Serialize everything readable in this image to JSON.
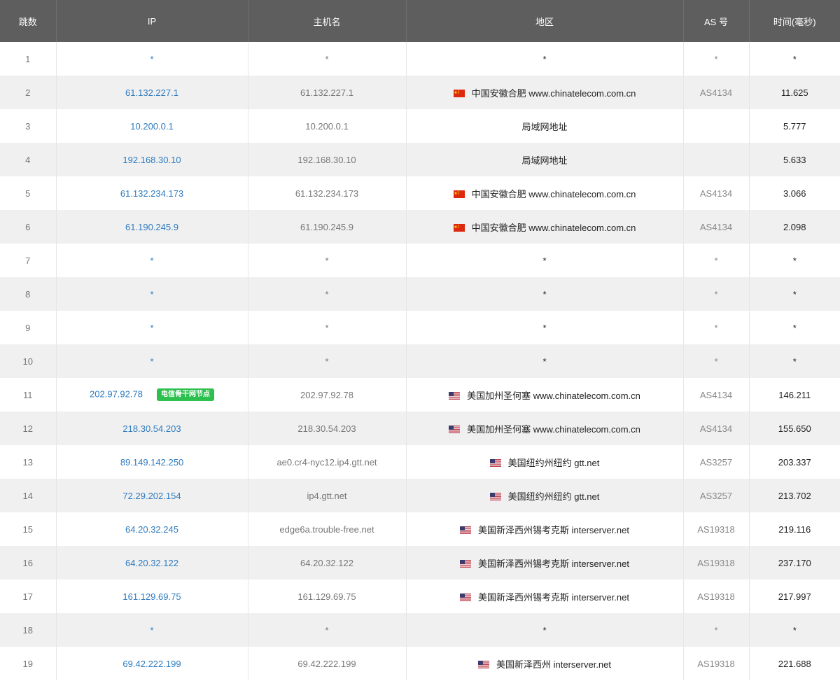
{
  "columns": [
    "跳数",
    "IP",
    "主机名",
    "地区",
    "AS 号",
    "时间(毫秒)"
  ],
  "rows": [
    {
      "hop": "1",
      "ip": "*",
      "host": "*",
      "flag": "",
      "region": "*",
      "as": "*",
      "time": "*"
    },
    {
      "hop": "2",
      "ip": "61.132.227.1",
      "host": "61.132.227.1",
      "flag": "cn-flag-icon",
      "region": "中国安徽合肥 www.chinatelecom.com.cn",
      "as": "AS4134",
      "time": "11.625"
    },
    {
      "hop": "3",
      "ip": "10.200.0.1",
      "host": "10.200.0.1",
      "flag": "",
      "region": "局域网地址",
      "as": "",
      "time": "5.777"
    },
    {
      "hop": "4",
      "ip": "192.168.30.10",
      "host": "192.168.30.10",
      "flag": "",
      "region": "局域网地址",
      "as": "",
      "time": "5.633"
    },
    {
      "hop": "5",
      "ip": "61.132.234.173",
      "host": "61.132.234.173",
      "flag": "cn-flag-icon",
      "region": "中国安徽合肥 www.chinatelecom.com.cn",
      "as": "AS4134",
      "time": "3.066"
    },
    {
      "hop": "6",
      "ip": "61.190.245.9",
      "host": "61.190.245.9",
      "flag": "cn-flag-icon",
      "region": "中国安徽合肥 www.chinatelecom.com.cn",
      "as": "AS4134",
      "time": "2.098"
    },
    {
      "hop": "7",
      "ip": "*",
      "host": "*",
      "flag": "",
      "region": "*",
      "as": "*",
      "time": "*"
    },
    {
      "hop": "8",
      "ip": "*",
      "host": "*",
      "flag": "",
      "region": "*",
      "as": "*",
      "time": "*"
    },
    {
      "hop": "9",
      "ip": "*",
      "host": "*",
      "flag": "",
      "region": "*",
      "as": "*",
      "time": "*"
    },
    {
      "hop": "10",
      "ip": "*",
      "host": "*",
      "flag": "",
      "region": "*",
      "as": "*",
      "time": "*"
    },
    {
      "hop": "11",
      "ip": "202.97.92.78",
      "badge": "电信骨干网节点",
      "host": "202.97.92.78",
      "flag": "us-flag-icon",
      "region": "美国加州圣何塞 www.chinatelecom.com.cn",
      "as": "AS4134",
      "time": "146.211"
    },
    {
      "hop": "12",
      "ip": "218.30.54.203",
      "host": "218.30.54.203",
      "flag": "us-flag-icon",
      "region": "美国加州圣何塞 www.chinatelecom.com.cn",
      "as": "AS4134",
      "time": "155.650"
    },
    {
      "hop": "13",
      "ip": "89.149.142.250",
      "host": "ae0.cr4-nyc12.ip4.gtt.net",
      "flag": "us-flag-icon",
      "region": "美国纽约州纽约 gtt.net",
      "as": "AS3257",
      "time": "203.337"
    },
    {
      "hop": "14",
      "ip": "72.29.202.154",
      "host": "ip4.gtt.net",
      "flag": "us-flag-icon",
      "region": "美国纽约州纽约 gtt.net",
      "as": "AS3257",
      "time": "213.702"
    },
    {
      "hop": "15",
      "ip": "64.20.32.245",
      "host": "edge6a.trouble-free.net",
      "flag": "us-flag-icon",
      "region": "美国新泽西州锡考克斯 interserver.net",
      "as": "AS19318",
      "time": "219.116"
    },
    {
      "hop": "16",
      "ip": "64.20.32.122",
      "host": "64.20.32.122",
      "flag": "us-flag-icon",
      "region": "美国新泽西州锡考克斯 interserver.net",
      "as": "AS19318",
      "time": "237.170"
    },
    {
      "hop": "17",
      "ip": "161.129.69.75",
      "host": "161.129.69.75",
      "flag": "us-flag-icon",
      "region": "美国新泽西州锡考克斯 interserver.net",
      "as": "AS19318",
      "time": "217.997"
    },
    {
      "hop": "18",
      "ip": "*",
      "host": "*",
      "flag": "",
      "region": "*",
      "as": "*",
      "time": "*"
    },
    {
      "hop": "19",
      "ip": "69.42.222.199",
      "host": "69.42.222.199",
      "flag": "us-flag-icon",
      "region": "美国新泽西州 interserver.net",
      "as": "AS19318",
      "time": "221.688"
    }
  ],
  "colors": {
    "header_bg": "#5e5e5e",
    "ip_link": "#2f7bbf",
    "badge_bg": "#2ec04f",
    "row_alt": "#f0f0f0"
  }
}
